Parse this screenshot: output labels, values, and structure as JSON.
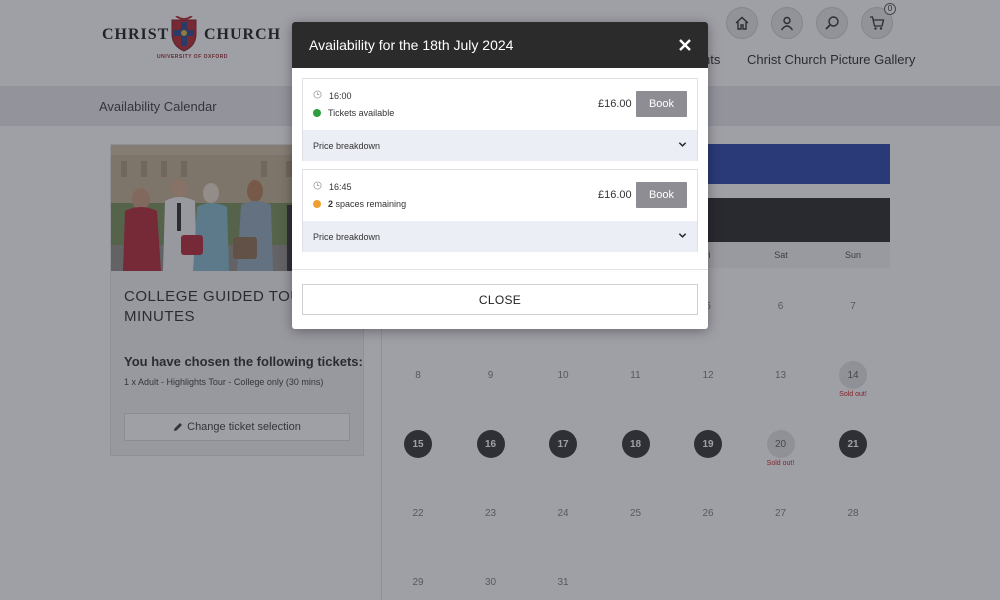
{
  "brand": {
    "left": "CHRIST",
    "right": "CHURCH",
    "sub": "UNIVERSITY OF OXFORD"
  },
  "header": {
    "cart_count": "0",
    "nav": [
      "nts",
      "Christ Church Picture Gallery"
    ]
  },
  "subbar": {
    "label": "Availability Calendar"
  },
  "tour_card": {
    "title": "COLLEGE GUIDED TOUR\nMINUTES",
    "chosen_heading": "You have chosen the following tickets:",
    "chosen_value": "1 x Adult - Highlights Tour - College only (30 mins)",
    "change_label": "Change ticket selection"
  },
  "calendar": {
    "weekdays": [
      "ri",
      "Sat",
      "Sun"
    ],
    "rows": [
      [
        {
          "d": "5"
        },
        {
          "d": "6"
        },
        {
          "d": "7"
        }
      ],
      [
        {
          "d": "8"
        },
        {
          "d": "9"
        },
        {
          "d": "10"
        },
        {
          "d": "11"
        },
        {
          "d": "12"
        },
        {
          "d": "13"
        },
        {
          "d": "14",
          "state": "sold",
          "label": "Sold out!"
        }
      ],
      [
        {
          "d": "15",
          "state": "avail"
        },
        {
          "d": "16",
          "state": "avail"
        },
        {
          "d": "17",
          "state": "avail"
        },
        {
          "d": "18",
          "state": "avail"
        },
        {
          "d": "19",
          "state": "avail"
        },
        {
          "d": "20",
          "state": "sold",
          "label": "Sold out!"
        },
        {
          "d": "21",
          "state": "avail"
        }
      ],
      [
        {
          "d": "22"
        },
        {
          "d": "23"
        },
        {
          "d": "24"
        },
        {
          "d": "25"
        },
        {
          "d": "26"
        },
        {
          "d": "27"
        },
        {
          "d": "28"
        }
      ],
      [
        {
          "d": "29"
        },
        {
          "d": "30"
        },
        {
          "d": "31"
        }
      ]
    ]
  },
  "modal": {
    "title": "Availability for the 18th July 2024",
    "close_label": "CLOSE",
    "slots": [
      {
        "time": "16:00",
        "status": "Tickets available",
        "status_color": "#2e9e3e",
        "price": "£16.00",
        "book_label": "Book",
        "breakdown_label": "Price breakdown"
      },
      {
        "time": "16:45",
        "status_count": "2",
        "status": "spaces remaining",
        "status_color": "#f0a030",
        "price": "£16.00",
        "book_label": "Book",
        "breakdown_label": "Price breakdown"
      }
    ]
  },
  "colors": {
    "accent_blue": "#1f3fa8",
    "modal_header": "#2b2b2b",
    "book_button": "#8d8d93",
    "sold_out": "#cc1111"
  }
}
